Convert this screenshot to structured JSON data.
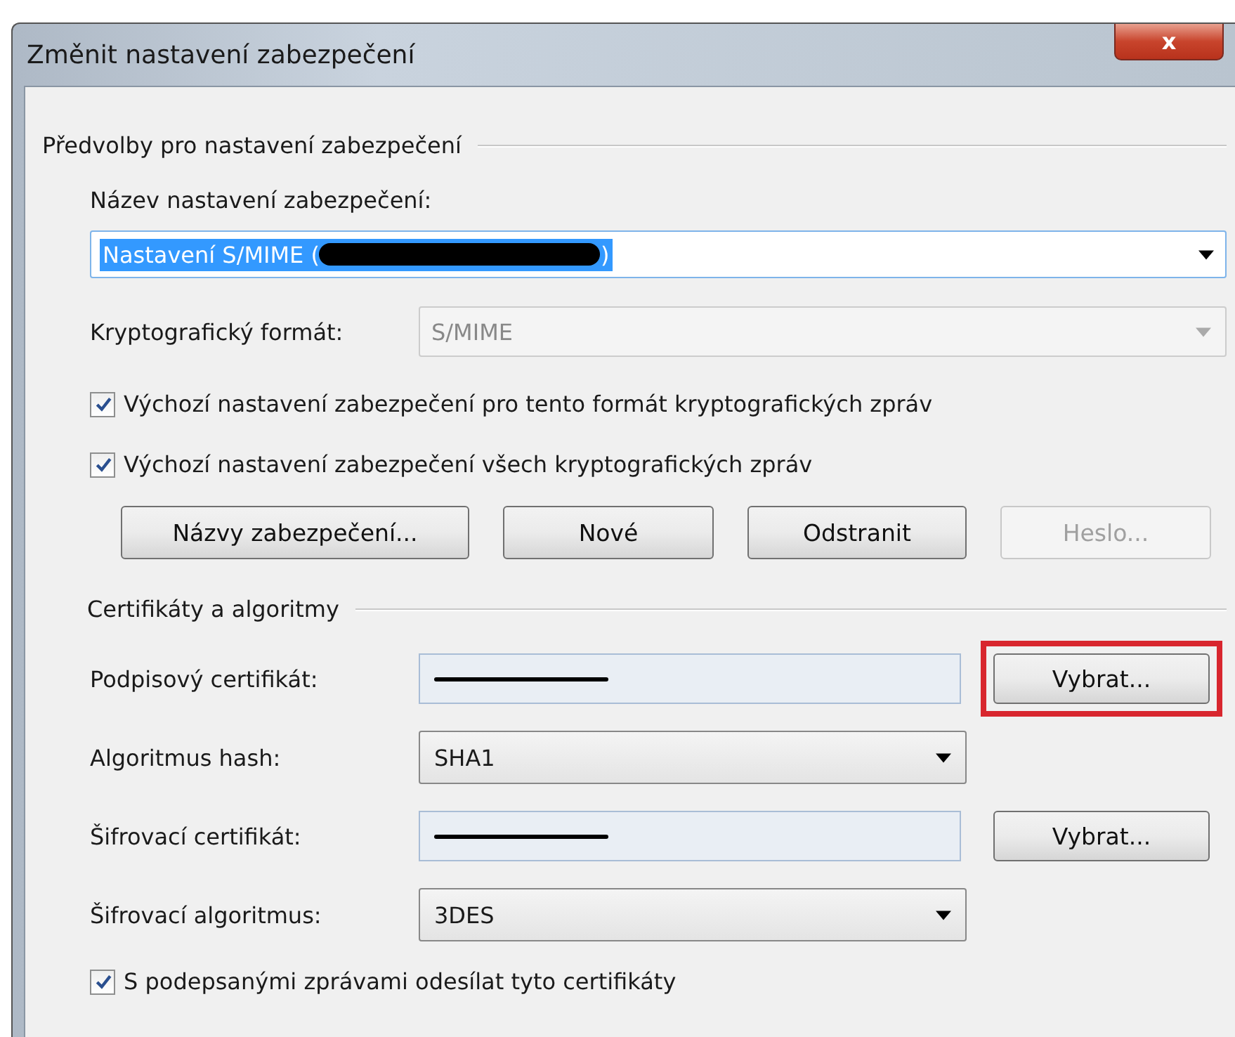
{
  "window": {
    "title": "Změnit nastavení zabezpečení",
    "close": "x"
  },
  "preferences": {
    "title": "Předvolby pro nastavení zabezpečení",
    "name_label": "Název nastavení zabezpečení:",
    "name_value_before": "Nastavení S/MIME (",
    "name_value_after": ")",
    "name_redacted": true,
    "format_label": "Kryptografický formát:",
    "format_value": "S/MIME",
    "format_disabled": true,
    "checkboxes": [
      {
        "label": "Výchozí nastavení zabezpečení pro tento formát kryptografických zpráv",
        "checked": true
      },
      {
        "label": "Výchozí nastavení zabezpečení všech kryptografických zpráv",
        "checked": true
      }
    ],
    "buttons": [
      {
        "label": "Názvy zabezpečení...",
        "disabled": false
      },
      {
        "label": "Nové",
        "disabled": false
      },
      {
        "label": "Odstranit",
        "disabled": false
      },
      {
        "label": "Heslo...",
        "disabled": true
      }
    ]
  },
  "certificates": {
    "title": "Certifikáty a algoritmy",
    "rows": [
      {
        "kind": "certificate",
        "label": "Podpisový certifikát:",
        "redacted": true,
        "button": "Vybrat...",
        "highlighted": true
      },
      {
        "kind": "dropdown",
        "label": "Algoritmus hash:",
        "value": "SHA1"
      },
      {
        "kind": "certificate",
        "label": "Šifrovací certifikát:",
        "redacted": true,
        "button": "Vybrat...",
        "highlighted": false
      },
      {
        "kind": "dropdown",
        "label": "Šifrovací algoritmus:",
        "value": "3DES"
      }
    ],
    "send_certificates": {
      "label": "S podepsanými zprávami odesílat tyto certifikáty",
      "checked": true
    }
  }
}
